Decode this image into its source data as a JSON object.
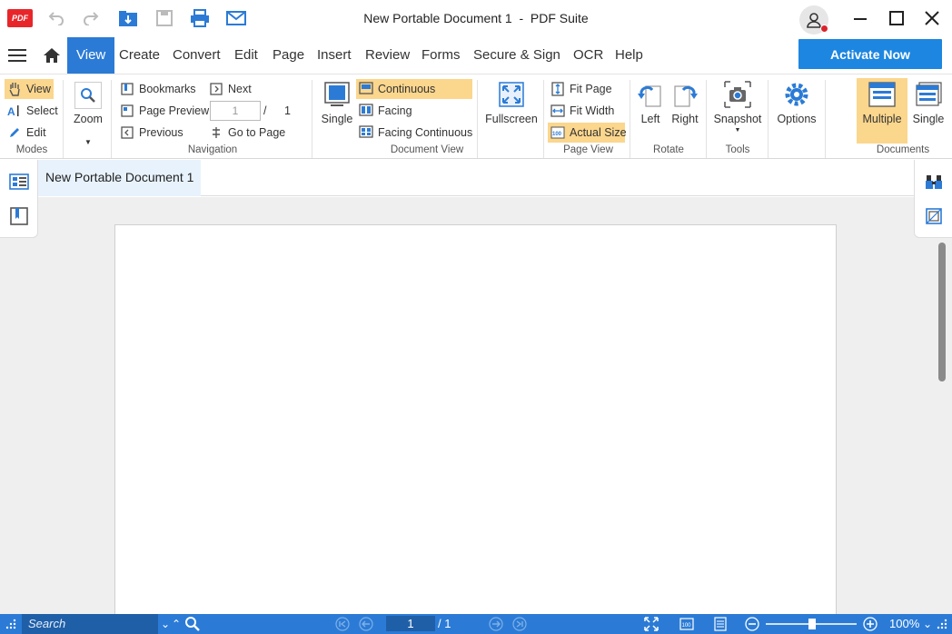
{
  "app": {
    "logo_text": "PDF",
    "document_name": "New Portable Document 1",
    "separator": "-",
    "app_name": "PDF Suite"
  },
  "menu": {
    "items": [
      "View",
      "Create",
      "Convert",
      "Edit",
      "Page",
      "Insert",
      "Review",
      "Forms",
      "Secure & Sign",
      "OCR",
      "Help"
    ],
    "active": "View",
    "activate_label": "Activate Now"
  },
  "ribbon": {
    "modes": {
      "view": "View",
      "select": "Select",
      "edit": "Edit",
      "label": "Modes"
    },
    "zoom": {
      "label": "Zoom"
    },
    "navigation": {
      "bookmarks": "Bookmarks",
      "page_preview": "Page Preview",
      "previous": "Previous",
      "next": "Next",
      "page_value": "1",
      "page_sep": "/",
      "page_total": "1",
      "go_to_page": "Go to Page",
      "label": "Navigation"
    },
    "document_view": {
      "single": "Single",
      "continuous": "Continuous",
      "facing": "Facing",
      "facing_continuous": "Facing Continuous",
      "label": "Document View"
    },
    "fullscreen": "Fullscreen",
    "page_view": {
      "fit_page": "Fit Page",
      "fit_width": "Fit Width",
      "actual_size": "Actual Size",
      "label": "Page View"
    },
    "rotate": {
      "left": "Left",
      "right": "Right",
      "label": "Rotate"
    },
    "tools": {
      "snapshot": "Snapshot",
      "label": "Tools"
    },
    "options": "Options",
    "documents": {
      "multiple": "Multiple",
      "single": "Single",
      "label": "Documents"
    }
  },
  "doc_tab": {
    "title": "New Portable Document 1"
  },
  "status": {
    "search_placeholder": "Search",
    "page_value": "1",
    "page_total": "/ 1",
    "zoom_level": "100%",
    "zoom_fraction": 0.5
  },
  "colors": {
    "accent": "#2b7bd6",
    "activate": "#1d86e0",
    "highlight": "#fbd68d",
    "logo": "#e8262a"
  }
}
